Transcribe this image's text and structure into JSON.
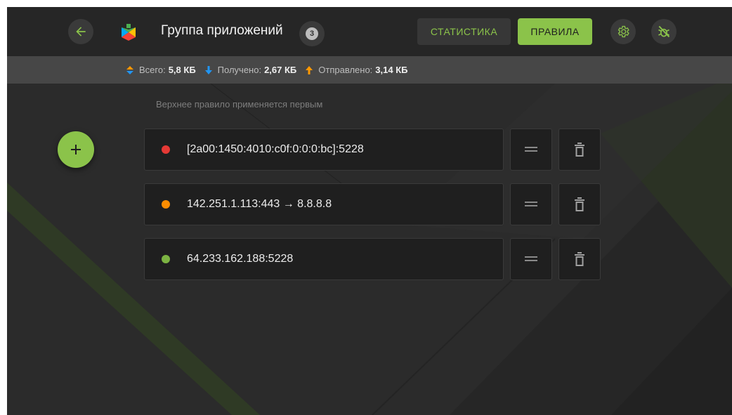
{
  "header": {
    "title": "Группа приложений",
    "count_badge": "3",
    "tabs": [
      {
        "label": "СТАТИСТИКА",
        "active": false
      },
      {
        "label": "ПРАВИЛА",
        "active": true
      }
    ],
    "icons": {
      "back": "arrow-left-icon",
      "app": "google-play-icon",
      "settings": "gear-icon",
      "firewall": "bug-off-icon"
    }
  },
  "stats": {
    "total_label": "Всего:",
    "total_value": "5,8 КБ",
    "received_label": "Получено:",
    "received_value": "2,67 КБ",
    "sent_label": "Отправлено:",
    "sent_value": "3,14 КБ"
  },
  "hint": "Верхнее правило применяется первым",
  "rules": [
    {
      "text": "[2a00:1450:4010:c0f:0:0:0:bc]:5228",
      "status_color": "#e53935"
    },
    {
      "text": "142.251.1.113:443 → 8.8.8.8",
      "status_color": "#fb8c00"
    },
    {
      "text": "64.233.162.188:5228",
      "status_color": "#7cb342"
    }
  ],
  "colors": {
    "accent": "#8bc34a",
    "background": "#2b2b2b",
    "topbar": "#262626",
    "statsbar": "#474747",
    "card": "#1f1f1f"
  }
}
